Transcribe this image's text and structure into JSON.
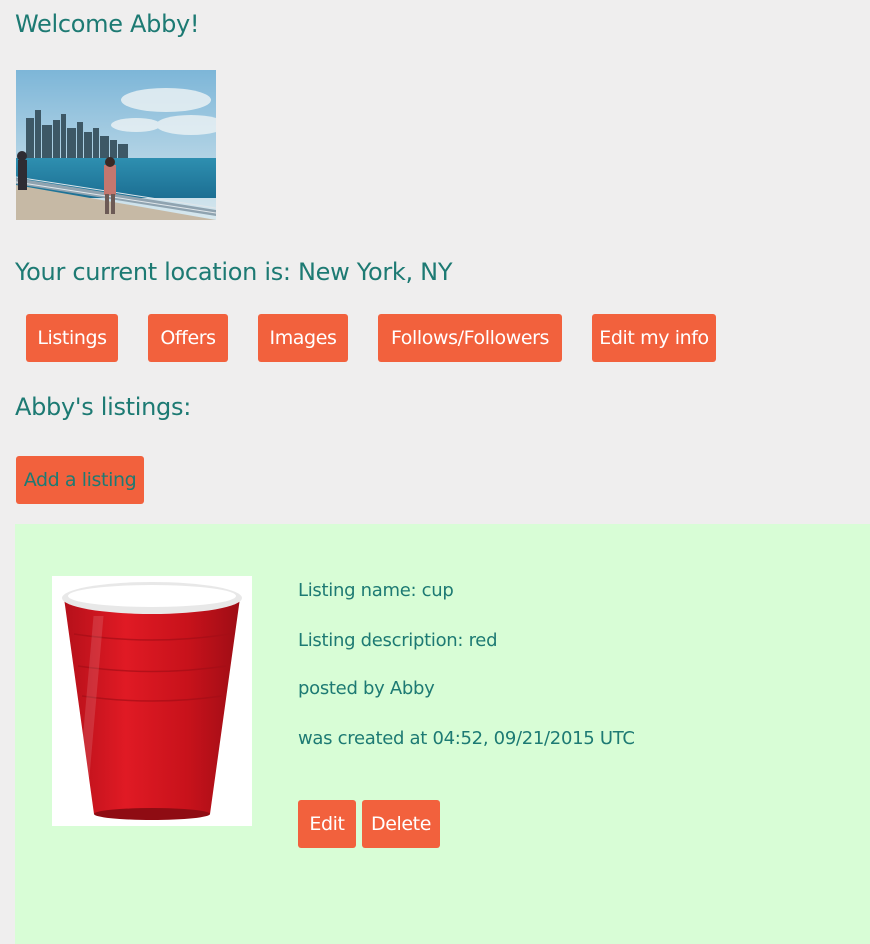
{
  "header": {
    "welcome": "Welcome Abby!"
  },
  "profile": {
    "location_text": "Your current location is: New York, NY"
  },
  "nav": {
    "listings": "Listings",
    "offers": "Offers",
    "images": "Images",
    "follows": "Follows/Followers",
    "edit_info": "Edit my info"
  },
  "listings_section": {
    "heading": "Abby's listings:",
    "add_button": "Add a listing"
  },
  "listing": {
    "name_label": "Listing name: cup",
    "description_label": "Listing description: red",
    "posted_by": "posted by Abby",
    "created_at": "was created at 04:52, 09/21/2015 UTC",
    "edit_button": "Edit",
    "delete_button": "Delete"
  },
  "colors": {
    "accent": "#f2613d",
    "text": "#1d7a73",
    "card_bg": "#d8fdd6",
    "page_bg": "#efeeee"
  }
}
